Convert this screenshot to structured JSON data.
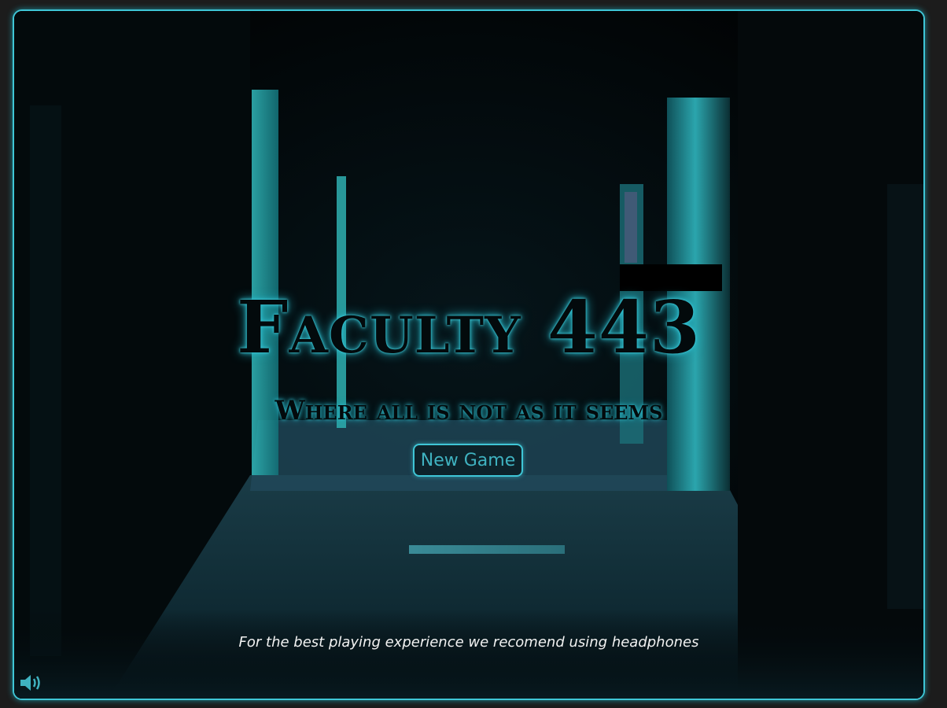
{
  "game": {
    "title": "Faculty 443",
    "subtitle": "Where all is not as it seems",
    "new_game_label": "New Game",
    "headphones_note": "For the best playing experience we recomend using headphones",
    "loading_progress": 1.0
  },
  "icons": {
    "sound": "speaker-volume-icon"
  },
  "colors": {
    "accent": "#3fc6d6",
    "background": "#020608",
    "page_bg": "#1c1c1c",
    "button_text": "#3fb2c0",
    "note_text": "#f2f2f2"
  }
}
